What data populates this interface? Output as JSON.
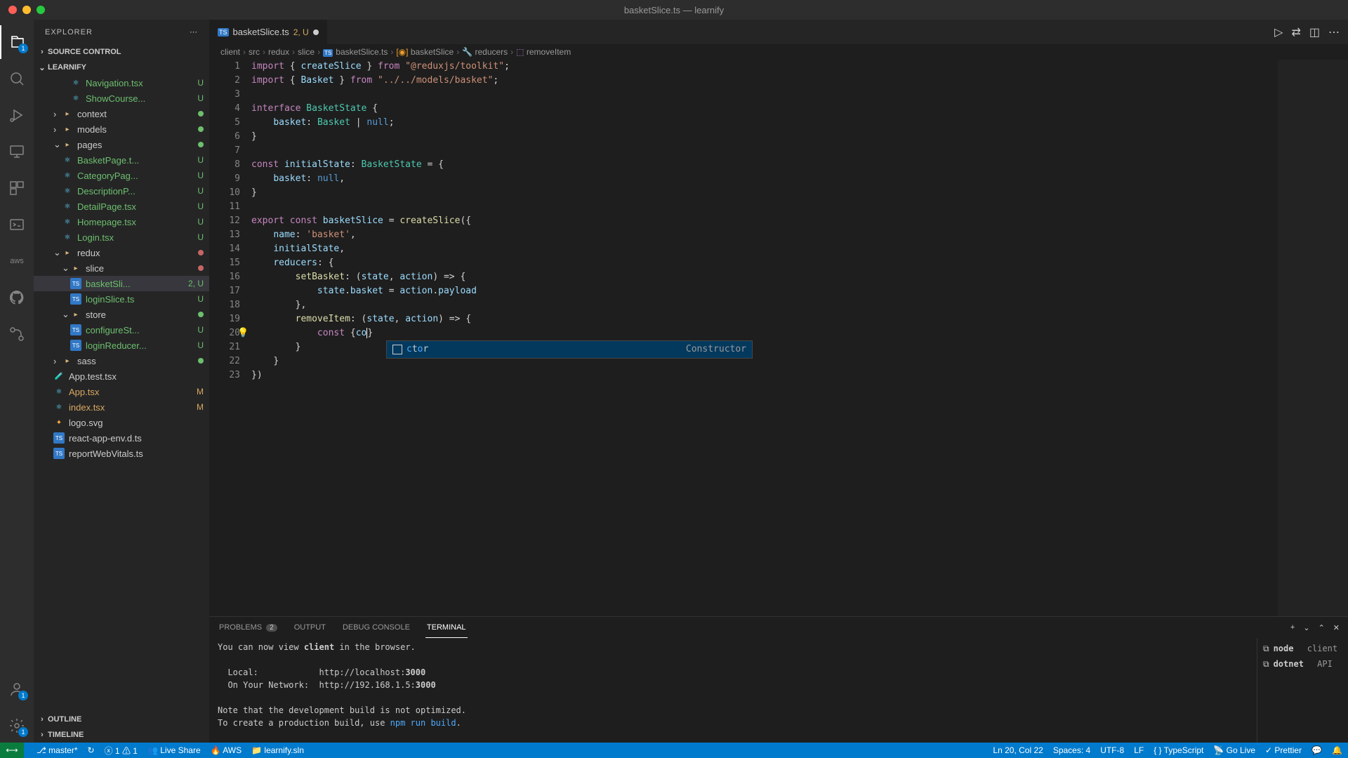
{
  "window": {
    "title": "basketSlice.ts — learnify"
  },
  "sidebar": {
    "header": "EXPLORER",
    "sections": [
      "SOURCE CONTROL",
      "LEARNIFY",
      "OUTLINE",
      "TIMELINE"
    ],
    "tree": [
      {
        "label": "Navigation.tsx",
        "indent": 4,
        "status": "U",
        "icon": "react"
      },
      {
        "label": "ShowCourse...",
        "indent": 4,
        "status": "U",
        "icon": "react"
      },
      {
        "label": "context",
        "indent": 2,
        "folder": true,
        "dot": "green"
      },
      {
        "label": "models",
        "indent": 2,
        "folder": true,
        "dot": "green"
      },
      {
        "label": "pages",
        "indent": 2,
        "folder": true,
        "expanded": true,
        "dot": "green"
      },
      {
        "label": "BasketPage.t...",
        "indent": 3,
        "status": "U",
        "icon": "react"
      },
      {
        "label": "CategoryPag...",
        "indent": 3,
        "status": "U",
        "icon": "react"
      },
      {
        "label": "DescriptionP...",
        "indent": 3,
        "status": "U",
        "icon": "react"
      },
      {
        "label": "DetailPage.tsx",
        "indent": 3,
        "status": "U",
        "icon": "react"
      },
      {
        "label": "Homepage.tsx",
        "indent": 3,
        "status": "U",
        "icon": "react"
      },
      {
        "label": "Login.tsx",
        "indent": 3,
        "status": "U",
        "icon": "react"
      },
      {
        "label": "redux",
        "indent": 2,
        "folder": true,
        "expanded": true,
        "dot": "red"
      },
      {
        "label": "slice",
        "indent": 3,
        "folder": true,
        "expanded": true,
        "dot": "red"
      },
      {
        "label": "basketSli...",
        "indent": 4,
        "status": "2, U",
        "icon": "ts",
        "selected": true
      },
      {
        "label": "loginSlice.ts",
        "indent": 4,
        "status": "U",
        "icon": "ts"
      },
      {
        "label": "store",
        "indent": 3,
        "folder": true,
        "expanded": true,
        "dot": "green"
      },
      {
        "label": "configureSt...",
        "indent": 4,
        "status": "U",
        "icon": "ts"
      },
      {
        "label": "loginReducer...",
        "indent": 4,
        "status": "U",
        "icon": "ts"
      },
      {
        "label": "sass",
        "indent": 2,
        "folder": true,
        "dot": "green"
      },
      {
        "label": "App.test.tsx",
        "indent": 2,
        "icon": "flask"
      },
      {
        "label": "App.tsx",
        "indent": 2,
        "status": "M",
        "icon": "react"
      },
      {
        "label": "index.tsx",
        "indent": 2,
        "status": "M",
        "icon": "react"
      },
      {
        "label": "logo.svg",
        "indent": 2,
        "icon": "svg"
      },
      {
        "label": "react-app-env.d.ts",
        "indent": 2,
        "icon": "ts"
      },
      {
        "label": "reportWebVitals.ts",
        "indent": 2,
        "icon": "ts"
      }
    ]
  },
  "tab": {
    "name": "basketSlice.ts",
    "modifier": "2, U"
  },
  "breadcrumbs": [
    "client",
    "src",
    "redux",
    "slice",
    "basketSlice.ts",
    "basketSlice",
    "reducers",
    "removeItem"
  ],
  "code_lines": 23,
  "suggest": {
    "text": "ctor",
    "detail": "Constructor"
  },
  "panel": {
    "tabs": [
      "PROBLEMS",
      "OUTPUT",
      "DEBUG CONSOLE",
      "TERMINAL"
    ],
    "problems_count": "2",
    "terminal_text": "You can now view client in the browser.\n\n  Local:            http://localhost:3000\n  On Your Network:  http://192.168.1.5:3000\n\nNote that the development build is not optimized.\nTo create a production build, use npm run build.\n\n▯",
    "terminals": [
      {
        "name": "node",
        "label": "client"
      },
      {
        "name": "dotnet",
        "label": "API"
      }
    ]
  },
  "statusbar": {
    "branch": "master*",
    "sync": "↻",
    "errors": "1",
    "warnings": "1",
    "liveshare": "Live Share",
    "aws": "AWS",
    "sln": "learnify.sln",
    "position": "Ln 20, Col 22",
    "spaces": "Spaces: 4",
    "encoding": "UTF-8",
    "eol": "LF",
    "lang": "TypeScript",
    "golive": "Go Live",
    "prettier": "Prettier"
  }
}
